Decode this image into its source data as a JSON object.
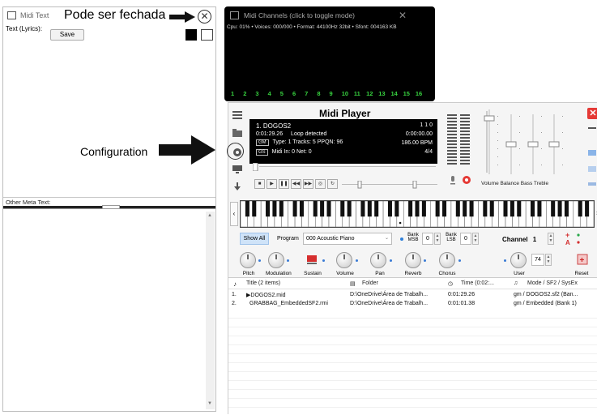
{
  "midi_text": {
    "title": "Midi Text",
    "callout": "Pode ser fechada",
    "close_glyph": "✕",
    "lyrics_label": "Text (Lyrics):",
    "save_label": "Save",
    "other_meta_label": "Other Meta Text:"
  },
  "channels": {
    "title": "Midi Channels (click to toggle mode)",
    "close_glyph": "✕",
    "info": "Cpu: 01% • Voices: 000/000 • Format: 44100Hz 32bit • Sfont: 004163 KB",
    "numbers": [
      "1",
      "2",
      "3",
      "4",
      "5",
      "6",
      "7",
      "8",
      "9",
      "10",
      "11",
      "12",
      "13",
      "14",
      "15",
      "16"
    ]
  },
  "player": {
    "title": "Midi Player",
    "close_glyph": "✕",
    "display": {
      "song": "1. DOGOS2",
      "counter": "1  1  0",
      "time": "0:01:29.26",
      "loop": "Loop detected",
      "elapsed": "0:00:00.00",
      "gm_tag": "GM",
      "type_line": "Type: 1  Tracks: 5  PPQN: 96",
      "bpm": "186.00 BPM",
      "gs_tag": "GS",
      "midi_in": "Midi In: 0  Net: 0",
      "time_sig": "4/4"
    },
    "slider_labels": "Volume  Balance  Bass  Treble",
    "show_all": "Show All",
    "program_label": "Program",
    "program_value": "000 Acoustic Piano",
    "bank_msb_label": "Bank MSB",
    "bank_msb_value": "0",
    "bank_lsb_label": "Bank LSB",
    "bank_lsb_value": "0",
    "channel_label": "Channel",
    "channel_value": "1",
    "user_value": "74",
    "knobs": {
      "pitch": "Pitch",
      "modulation": "Modulation",
      "sustain": "Sustain",
      "volume": "Volume",
      "pan": "Pan",
      "reverb": "Reverb",
      "chorus": "Chorus",
      "user": "User",
      "reset": "Reset"
    }
  },
  "config_callout": "Configuration",
  "file_list": {
    "headers": [
      "Title (2 items)",
      "Folder",
      "Time (0:02:...",
      "Mode / SF2 / SysEx"
    ],
    "rows": [
      {
        "num": "1.",
        "title": "▶DOGOS2.mid",
        "folder": "D:\\OneDrive\\Área de Trabalh...",
        "time": "0:01:29.26",
        "mode": "gm / DOGOS2.sf2 (Ban..."
      },
      {
        "num": "2.",
        "title": "GRABBAG_EmbeddedSF2.rmi",
        "folder": "D:\\OneDrive\\Área de Trabalh...",
        "time": "0:01:01.38",
        "mode": "gm / Embedded (Bank 1)"
      }
    ]
  },
  "colors": {
    "channel_numbers": "#37d13f",
    "close_red": "#e53935",
    "accent_blue": "#cfe3f8"
  }
}
